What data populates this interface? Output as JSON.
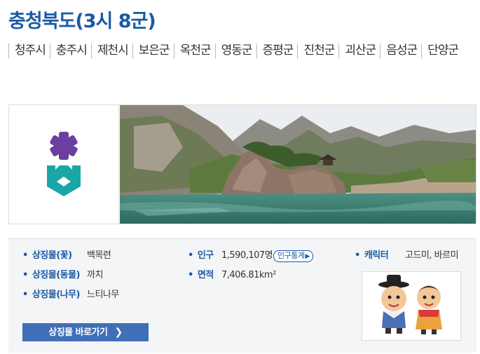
{
  "title": "충청북도(3시 8군)",
  "cities": [
    "청주시",
    "충주시",
    "제천시",
    "보은군",
    "옥천군",
    "영동군",
    "증평군",
    "진천군",
    "괴산군",
    "음성군",
    "단양군"
  ],
  "symbols": {
    "flower": {
      "label": "상징물(꽃)",
      "value": "백목련"
    },
    "animal": {
      "label": "상징물(동물)",
      "value": "까치"
    },
    "tree": {
      "label": "상징물(나무)",
      "value": "느티나무"
    }
  },
  "stats": {
    "population": {
      "label": "인구",
      "value": "1,590,107명",
      "button": "인구통계"
    },
    "area": {
      "label": "면적",
      "value": "7,406.81km²"
    }
  },
  "character": {
    "label": "캐릭터",
    "value": "고드미, 바르미"
  },
  "link_button": "상징물 바로가기",
  "colors": {
    "primary": "#1b5aa5",
    "button": "#3f6fb6",
    "logo_purple": "#6b3fa0",
    "logo_teal": "#1aa6a6"
  }
}
